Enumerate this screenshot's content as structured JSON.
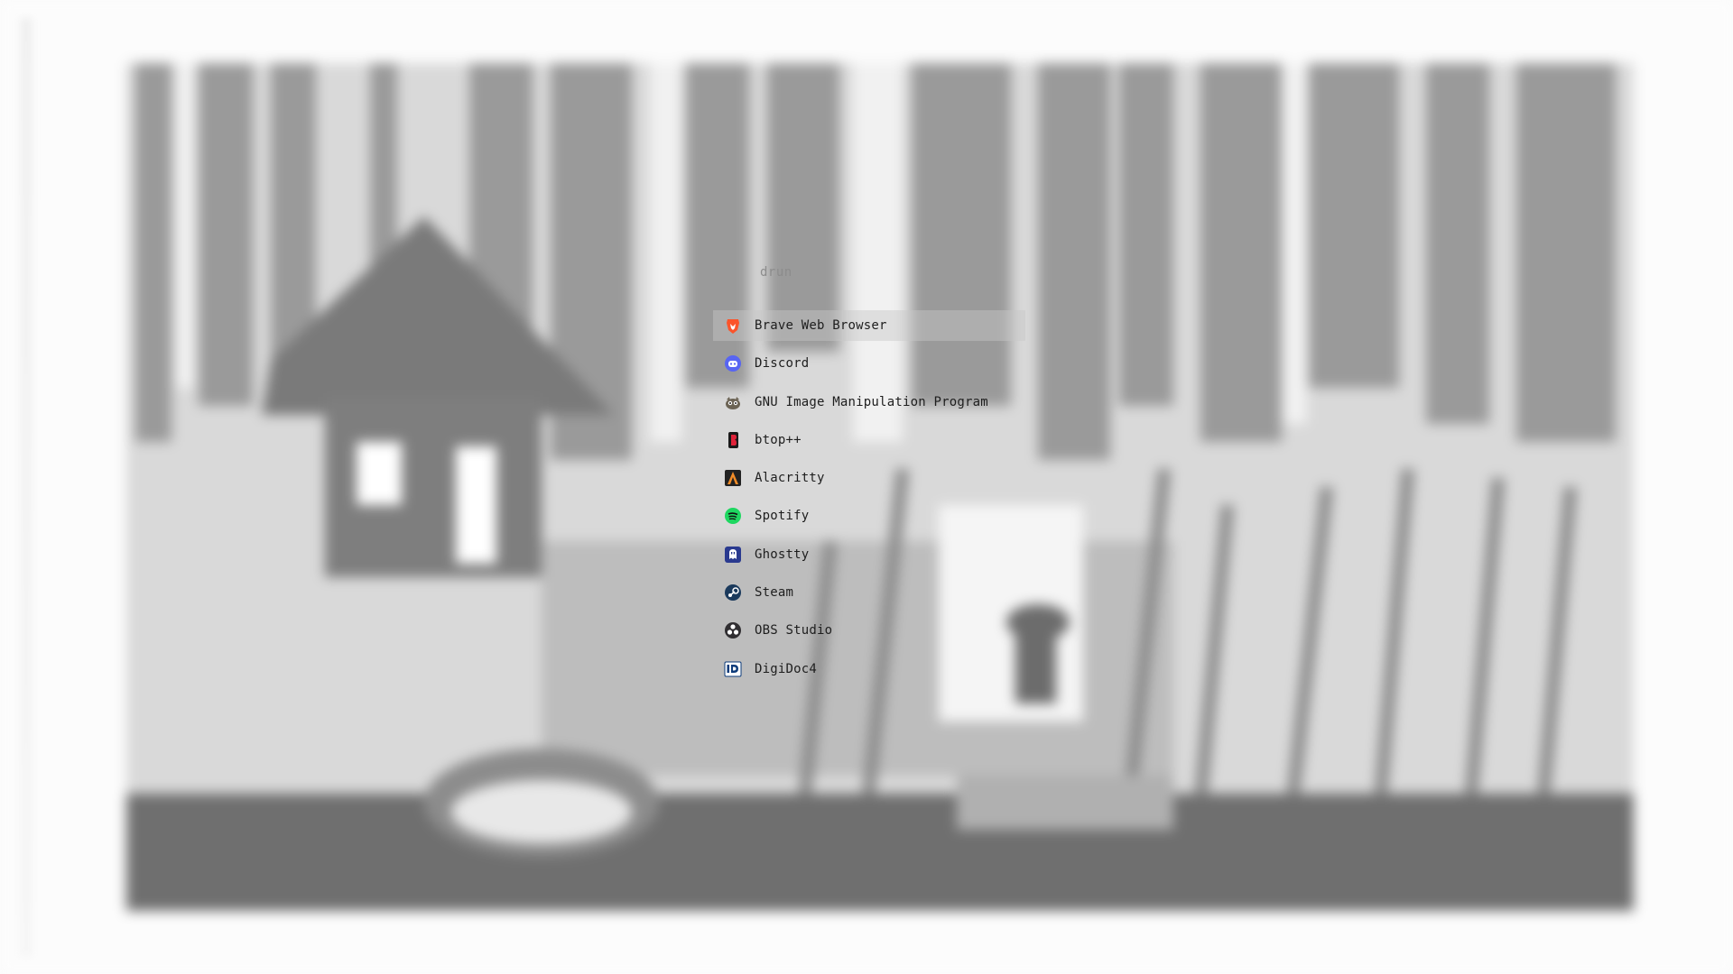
{
  "launcher": {
    "mode": "drun",
    "selected_index": 0,
    "entries": [
      {
        "label": "Brave Web Browser",
        "icon": "brave-icon"
      },
      {
        "label": "Discord",
        "icon": "discord-icon"
      },
      {
        "label": "GNU Image Manipulation Program",
        "icon": "gimp-icon"
      },
      {
        "label": "btop++",
        "icon": "btop-icon"
      },
      {
        "label": "Alacritty",
        "icon": "alacritty-icon"
      },
      {
        "label": "Spotify",
        "icon": "spotify-icon"
      },
      {
        "label": "Ghostty",
        "icon": "ghostty-icon"
      },
      {
        "label": "Steam",
        "icon": "steam-icon"
      },
      {
        "label": "OBS Studio",
        "icon": "obs-icon"
      },
      {
        "label": "DigiDoc4",
        "icon": "digidoc-icon"
      }
    ]
  },
  "colors": {
    "selection": "#d3d3d3",
    "text": "#1e1e1e",
    "mode_text": "#8c8c8c"
  }
}
